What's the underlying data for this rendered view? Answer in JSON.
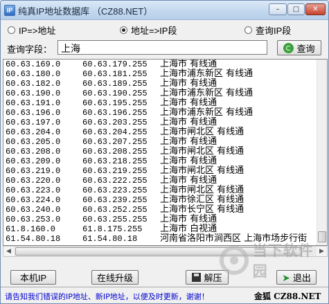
{
  "window": {
    "title": "纯真IP地址数据库 （CZ88.NET）",
    "icon_label": "IP",
    "controls": {
      "minimize": "–",
      "maximize": "□",
      "close": "✕"
    }
  },
  "modes": [
    {
      "label": "IP=>地址",
      "selected": false
    },
    {
      "label": "地址=>IP段",
      "selected": true
    },
    {
      "label": "查询IP段",
      "selected": false
    }
  ],
  "query": {
    "label": "查询字段：",
    "value": "上海",
    "button_label": "查询"
  },
  "results": [
    {
      "start": "60.63.169.0",
      "end": "60.63.179.255",
      "location": "上海市 有线通"
    },
    {
      "start": "60.63.180.0",
      "end": "60.63.181.255",
      "location": "上海市浦东新区 有线通"
    },
    {
      "start": "60.63.182.0",
      "end": "60.63.189.255",
      "location": "上海市 有线通"
    },
    {
      "start": "60.63.190.0",
      "end": "60.63.190.255",
      "location": "上海市浦东新区 有线通"
    },
    {
      "start": "60.63.191.0",
      "end": "60.63.195.255",
      "location": "上海市 有线通"
    },
    {
      "start": "60.63.196.0",
      "end": "60.63.196.255",
      "location": "上海市浦东新区 有线通"
    },
    {
      "start": "60.63.197.0",
      "end": "60.63.203.255",
      "location": "上海市 有线通"
    },
    {
      "start": "60.63.204.0",
      "end": "60.63.204.255",
      "location": "上海市闸北区 有线通"
    },
    {
      "start": "60.63.205.0",
      "end": "60.63.207.255",
      "location": "上海市 有线通"
    },
    {
      "start": "60.63.208.0",
      "end": "60.63.208.255",
      "location": "上海市闸北区 有线通"
    },
    {
      "start": "60.63.209.0",
      "end": "60.63.218.255",
      "location": "上海市 有线通"
    },
    {
      "start": "60.63.219.0",
      "end": "60.63.219.255",
      "location": "上海市闸北区 有线通"
    },
    {
      "start": "60.63.220.0",
      "end": "60.63.222.255",
      "location": "上海市 有线通"
    },
    {
      "start": "60.63.223.0",
      "end": "60.63.223.255",
      "location": "上海市闸北区 有线通"
    },
    {
      "start": "60.63.224.0",
      "end": "60.63.239.255",
      "location": "上海市徐汇区 有线通"
    },
    {
      "start": "60.63.240.0",
      "end": "60.63.252.255",
      "location": "上海市长宁区 有线通"
    },
    {
      "start": "60.63.253.0",
      "end": "60.63.255.255",
      "location": "上海市 有线通"
    },
    {
      "start": "61.8.160.0",
      "end": "61.8.175.255",
      "location": "上海市 白视通"
    },
    {
      "start": "61.54.80.18",
      "end": "61.54.80.18",
      "location": "河南省洛阳市涧西区 上海市场步行街"
    }
  ],
  "buttons": {
    "local_ip": "本机IP",
    "online_update": "在线升级",
    "extract": "解压",
    "exit": "退出"
  },
  "status": {
    "message": "请告知我们错误的IP地址、新IP地址，以便及时更新，谢谢！",
    "brand": "金狐 CZ88.NET"
  },
  "watermark": {
    "text": "当下软件园"
  }
}
